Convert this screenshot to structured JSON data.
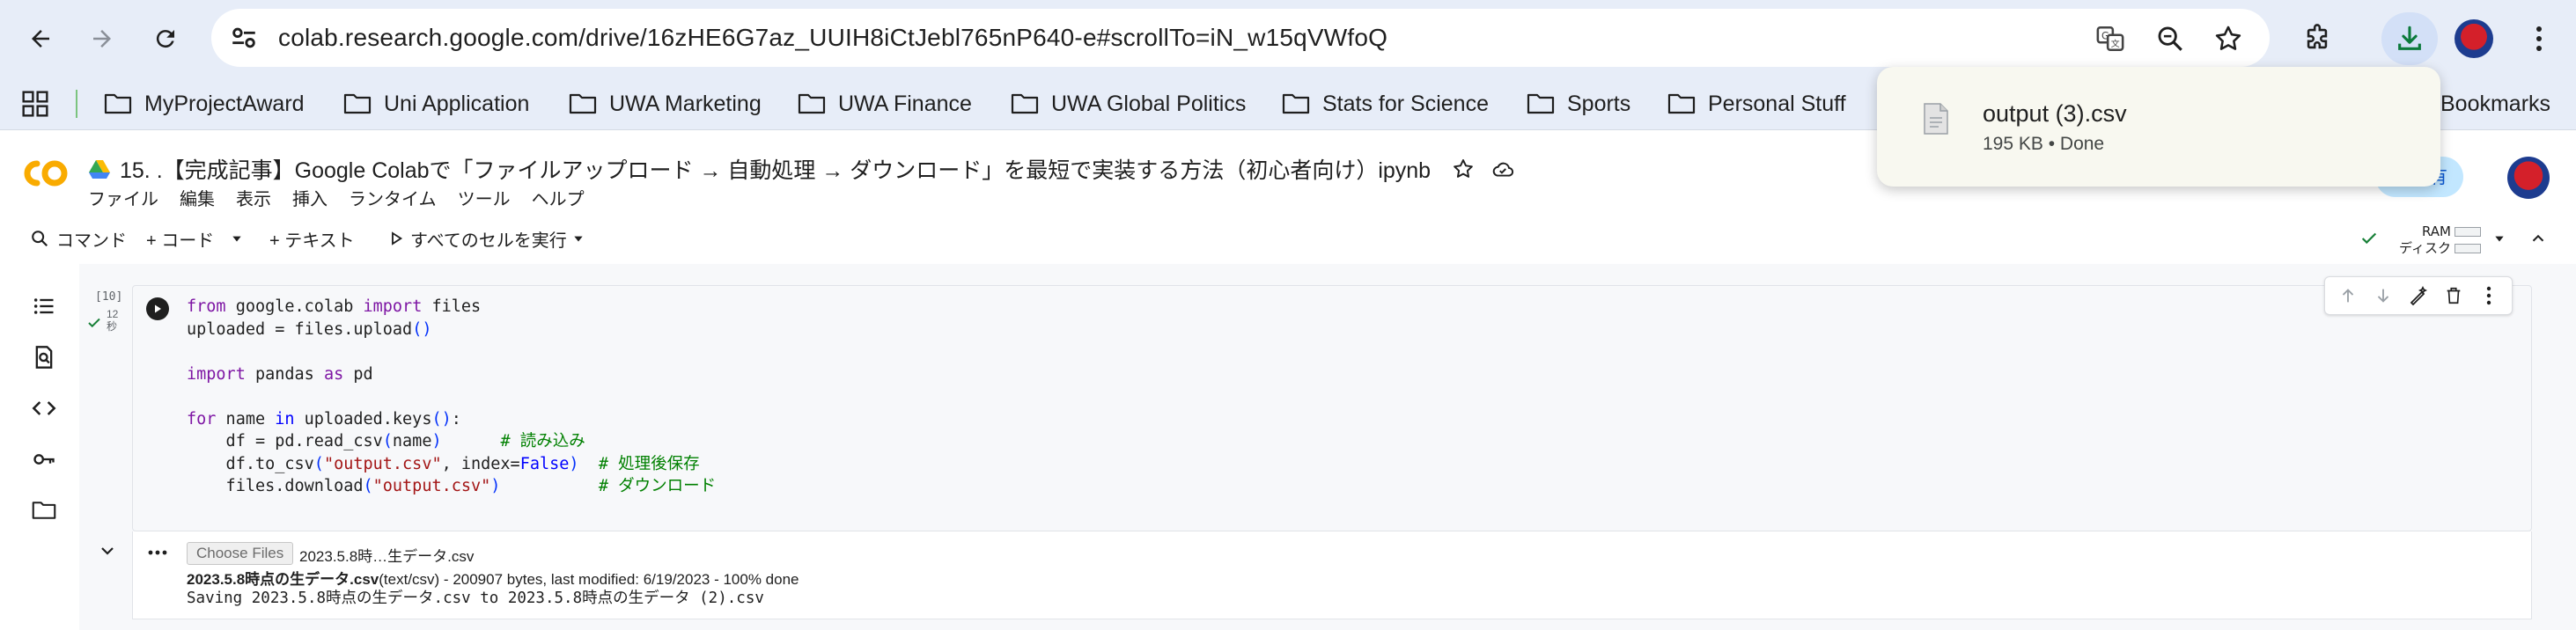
{
  "browser": {
    "url": "colab.research.google.com/drive/16zHE6G7az_UUIH8iCtJebl765nP640-e#scrollTo=iN_w15qVWfoQ"
  },
  "bookmarks": {
    "items": [
      {
        "label": "MyProjectAward"
      },
      {
        "label": "Uni Application"
      },
      {
        "label": "UWA Marketing"
      },
      {
        "label": "UWA Finance"
      },
      {
        "label": "UWA Global Politics"
      },
      {
        "label": "Stats for Science"
      },
      {
        "label": "Sports"
      },
      {
        "label": "Personal Stuff"
      }
    ],
    "all_bookmarks_label": "Bookmarks"
  },
  "colab": {
    "title": "15. .【完成記事】Google Colabで「ファイルアップロード → 自動処理 → ダウンロード」を最短で実装する方法（初心者向け）ipynb",
    "menu": [
      "ファイル",
      "編集",
      "表示",
      "挿入",
      "ランタイム",
      "ツール",
      "ヘルプ"
    ],
    "share_label": "共有",
    "toolbar": {
      "command": "コマンド",
      "code": "+ コード",
      "text": "+ テキスト",
      "run_all": "すべてのセルを実行",
      "ram": "RAM",
      "disk": "ディスク"
    }
  },
  "cell": {
    "exec_count": "[10]",
    "exec_time_num": "12",
    "exec_time_unit": "秒"
  },
  "code_lines": [
    "from google.colab import files",
    "uploaded = files.upload()",
    "import pandas as pd",
    "for name in uploaded.keys():",
    "df = pd.read_csv(name)",
    "# 読み込み",
    "df.to_csv(\"output.csv\", index=False)",
    "# 処理後保存",
    "files.download(\"output.csv\")",
    "# ダウンロード"
  ],
  "output": {
    "choose_files": "Choose Files",
    "chosen_file": "2023.5.8時…生データ.csv",
    "uploaded_name": "2023.5.8時点の生データ.csv",
    "uploaded_info": "(text/csv) - 200907 bytes, last modified: 6/19/2023 - 100% done",
    "saving_line": "Saving 2023.5.8時点の生データ.csv to 2023.5.8時点の生データ (2).csv"
  },
  "download_popup": {
    "filename": "output (3).csv",
    "status": "195 KB • Done"
  },
  "colors": {
    "browser_bg": "#e7edf8",
    "accent_blue": "#0b57d0",
    "download_active": "#d3e0f7",
    "colab_orange": "#f9ab00",
    "keyword_purple": "#7e16a4",
    "string_red": "#a31515",
    "comment_green": "#008000"
  }
}
